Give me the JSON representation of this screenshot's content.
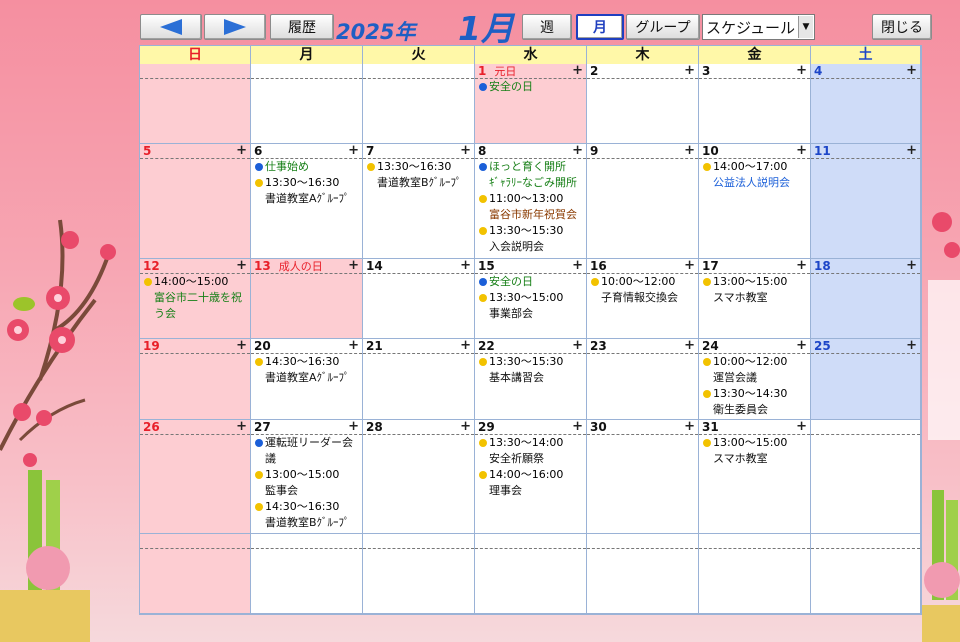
{
  "colors": {
    "sunday": "#e8202a",
    "saturday": "#1d46c8",
    "weekday": "#111111",
    "sunday_bg": "#fdcdd2",
    "saturday_bg": "#cfdcf8",
    "header_bg": "#fff8a8",
    "dot_blue": "#1b5fd8",
    "dot_yellow": "#f2c200",
    "green_text": "#188018",
    "blue_text": "#1b5fd8",
    "brown_text": "#8a3a00"
  },
  "toolbar": {
    "prev_label": "◀",
    "next_label": "▶",
    "history_label": "履歴",
    "year_label": "2025年",
    "month_label": "1月",
    "week_label": "週",
    "month_view_label": "月",
    "group_label": "グループ",
    "schedule_select": "スケジュール",
    "close_label": "閉じる"
  },
  "weekdays": [
    "日",
    "月",
    "火",
    "水",
    "木",
    "金",
    "土"
  ],
  "weeks": [
    [
      {
        "day": ""
      },
      {
        "day": ""
      },
      {
        "day": ""
      },
      {
        "day": "1",
        "holiday": "元日",
        "events": [
          {
            "dot": "blue",
            "title": "安全の日",
            "title_color": "green"
          }
        ]
      },
      {
        "day": "2"
      },
      {
        "day": "3"
      },
      {
        "day": "4"
      }
    ],
    [
      {
        "day": "5"
      },
      {
        "day": "6",
        "events": [
          {
            "dot": "blue",
            "title": "仕事始め",
            "title_color": "green"
          },
          {
            "dot": "yellow",
            "time": "13:30～16:30",
            "title": "書道教室Aｸﾞﾙｰﾌﾟ"
          }
        ]
      },
      {
        "day": "7",
        "events": [
          {
            "dot": "yellow",
            "time": "13:30～16:30",
            "title": "書道教室Bｸﾞﾙｰﾌﾟ"
          }
        ]
      },
      {
        "day": "8",
        "events": [
          {
            "dot": "blue",
            "title": "ほっと育く開所",
            "title_color": "green"
          },
          {
            "dot": "none",
            "title": "ｷﾞｬﾗﾘｰなごみ開所",
            "title_color": "green"
          },
          {
            "dot": "yellow",
            "time": "11:00～13:00",
            "title": "富谷市新年祝賀会",
            "title_color": "brown"
          },
          {
            "dot": "yellow",
            "time": "13:30～15:30",
            "title": "入会説明会"
          }
        ]
      },
      {
        "day": "9"
      },
      {
        "day": "10",
        "events": [
          {
            "dot": "yellow",
            "time": "14:00～17:00",
            "title": "公益法人説明会",
            "title_color": "blue"
          }
        ]
      },
      {
        "day": "11"
      }
    ],
    [
      {
        "day": "12",
        "events": [
          {
            "dot": "yellow",
            "time": "14:00～15:00",
            "title": "富谷市二十歳を祝う会",
            "title_color": "green",
            "wrap": true
          }
        ]
      },
      {
        "day": "13",
        "holiday": "成人の日"
      },
      {
        "day": "14"
      },
      {
        "day": "15",
        "events": [
          {
            "dot": "blue",
            "title": "安全の日",
            "title_color": "green"
          },
          {
            "dot": "yellow",
            "time": "13:30～15:00",
            "title": "事業部会"
          }
        ]
      },
      {
        "day": "16",
        "events": [
          {
            "dot": "yellow",
            "time": "10:00～12:00",
            "title": "子育情報交換会"
          }
        ]
      },
      {
        "day": "17",
        "events": [
          {
            "dot": "yellow",
            "time": "13:00～15:00",
            "title": "スマホ教室"
          }
        ]
      },
      {
        "day": "18"
      }
    ],
    [
      {
        "day": "19"
      },
      {
        "day": "20",
        "events": [
          {
            "dot": "yellow",
            "time": "14:30～16:30",
            "title": "書道教室Aｸﾞﾙｰﾌﾟ"
          }
        ]
      },
      {
        "day": "21"
      },
      {
        "day": "22",
        "events": [
          {
            "dot": "yellow",
            "time": "13:30～15:30",
            "title": "基本講習会"
          }
        ]
      },
      {
        "day": "23"
      },
      {
        "day": "24",
        "events": [
          {
            "dot": "yellow",
            "time": "10:00～12:00",
            "title": "運営会議"
          },
          {
            "dot": "yellow",
            "time": "13:30～14:30",
            "title": "衛生委員会"
          }
        ]
      },
      {
        "day": "25"
      }
    ],
    [
      {
        "day": "26"
      },
      {
        "day": "27",
        "events": [
          {
            "dot": "blue",
            "title": "運転班リーダー会議",
            "wrap": true
          },
          {
            "dot": "yellow",
            "time": "13:00～15:00",
            "title": "監事会"
          },
          {
            "dot": "yellow",
            "time": "14:30～16:30",
            "title": "書道教室Bｸﾞﾙｰﾌﾟ"
          }
        ]
      },
      {
        "day": "28"
      },
      {
        "day": "29",
        "events": [
          {
            "dot": "yellow",
            "time": "13:30～14:00",
            "title": "安全祈願祭"
          },
          {
            "dot": "yellow",
            "time": "14:00～16:00",
            "title": "理事会"
          }
        ]
      },
      {
        "day": "30"
      },
      {
        "day": "31",
        "events": [
          {
            "dot": "yellow",
            "time": "13:00～15:00",
            "title": "スマホ教室"
          }
        ]
      },
      {
        "day": ""
      }
    ],
    [
      {
        "day": ""
      },
      {
        "day": ""
      },
      {
        "day": ""
      },
      {
        "day": ""
      },
      {
        "day": ""
      },
      {
        "day": ""
      },
      {
        "day": ""
      }
    ]
  ]
}
